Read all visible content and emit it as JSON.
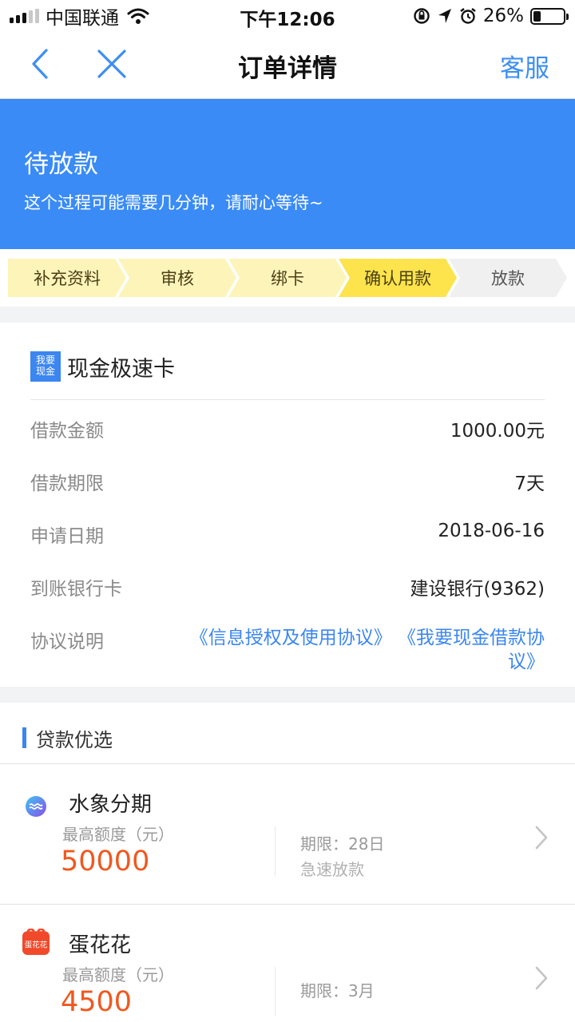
{
  "status_bar": {
    "carrier": "中国联通",
    "time": "下午12:06",
    "battery_text": "26%",
    "battery_level": 0.26
  },
  "nav": {
    "title": "订单详情",
    "service": "客服",
    "back_icon": "chevron-left-icon",
    "close_icon": "close-icon"
  },
  "banner": {
    "title": "待放款",
    "subtitle": "这个过程可能需要几分钟，请耐心等待~",
    "color": "#3a8bf5"
  },
  "steps": [
    {
      "label": "补充资料",
      "state": "done"
    },
    {
      "label": "审核",
      "state": "done"
    },
    {
      "label": "绑卡",
      "state": "done"
    },
    {
      "label": "确认用款",
      "state": "active"
    },
    {
      "label": "放款",
      "state": "pending"
    }
  ],
  "order": {
    "logo_text": "我要现金",
    "product_name": "现金极速卡",
    "rows": [
      {
        "label": "借款金额",
        "value": "1000.00元"
      },
      {
        "label": "借款期限",
        "value": "7天"
      },
      {
        "label": "申请日期",
        "value": "2018-06-16"
      },
      {
        "label": "到账银行卡",
        "value": "建设银行(9362)"
      }
    ],
    "agreement_label": "协议说明",
    "agreement_1": "《信息授权及使用协议》",
    "agreement_2": "《我要现金借款协议》"
  },
  "recommend": {
    "title": "贷款优选",
    "items": [
      {
        "name": "水象分期",
        "limit_label": "最高额度（元）",
        "amount": "50000",
        "term": "期限：28日",
        "feature": "急速放款",
        "icon": "water-drop-icon"
      },
      {
        "name": "蛋花花",
        "limit_label": "最高额度（元）",
        "amount": "4500",
        "term": "期限：3月",
        "feature": "",
        "icon": "danhuahua-logo-icon",
        "logo_text": "蛋花花"
      }
    ]
  },
  "colors": {
    "accent": "#3b86f0",
    "amount": "#f0581f",
    "step_active": "#fde34c",
    "step_done": "#fdf4ba"
  }
}
